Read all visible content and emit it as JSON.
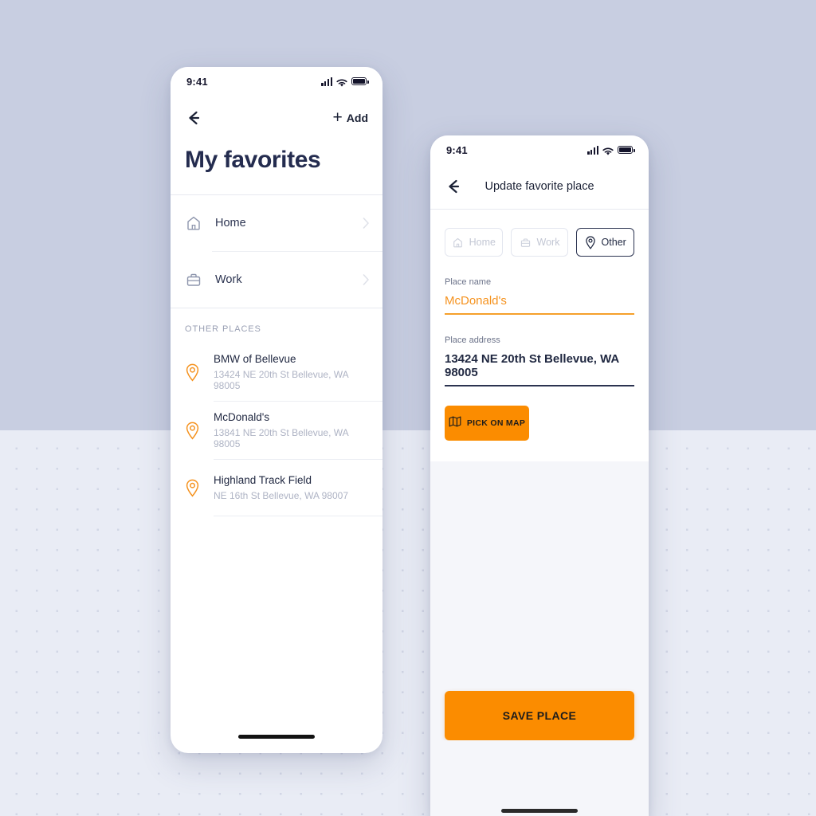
{
  "status_bar": {
    "time": "9:41"
  },
  "phone_favorites": {
    "nav": {
      "back_icon": "arrow-left-icon",
      "add_label": "Add",
      "add_icon": "plus-icon"
    },
    "title": "My favorites",
    "main_rows": [
      {
        "label": "Home",
        "icon": "house-icon"
      },
      {
        "label": "Work",
        "icon": "briefcase-icon"
      }
    ],
    "section_label": "OTHER PLACES",
    "places": [
      {
        "name": "BMW of Bellevue",
        "address": "13424 NE 20th St Bellevue, WA 98005",
        "icon": "map-pin-icon"
      },
      {
        "name": "McDonald's",
        "address": "13841 NE 20th St Bellevue, WA 98005",
        "icon": "map-pin-icon"
      },
      {
        "name": "Highland Track Field",
        "address": "NE 16th St Bellevue, WA 98007",
        "icon": "map-pin-icon"
      }
    ]
  },
  "phone_update": {
    "nav": {
      "back_icon": "arrow-left-icon",
      "title": "Update favorite place"
    },
    "chips": [
      {
        "label": "Home",
        "icon": "house-icon",
        "state": "disabled"
      },
      {
        "label": "Work",
        "icon": "briefcase-icon",
        "state": "disabled"
      },
      {
        "label": "Other",
        "icon": "map-pin-icon",
        "state": "selected"
      }
    ],
    "fields": [
      {
        "label": "Place name",
        "value": "McDonald's",
        "state": "active"
      },
      {
        "label": "Place address",
        "value": "13424 NE 20th St Bellevue, WA 98005",
        "state": "filled"
      }
    ],
    "pick_on_map": {
      "label": "PICK ON MAP",
      "icon": "map-icon"
    },
    "save": {
      "label": "SAVE PLACE"
    }
  },
  "colors": {
    "accent_orange": "#fb8c00",
    "field_active_orange": "#f5921e",
    "title_navy": "#242c4f",
    "bg_top": "#c8cee1",
    "bg_bottom": "#e9ecf5",
    "body_gray": "#f5f6fa"
  }
}
